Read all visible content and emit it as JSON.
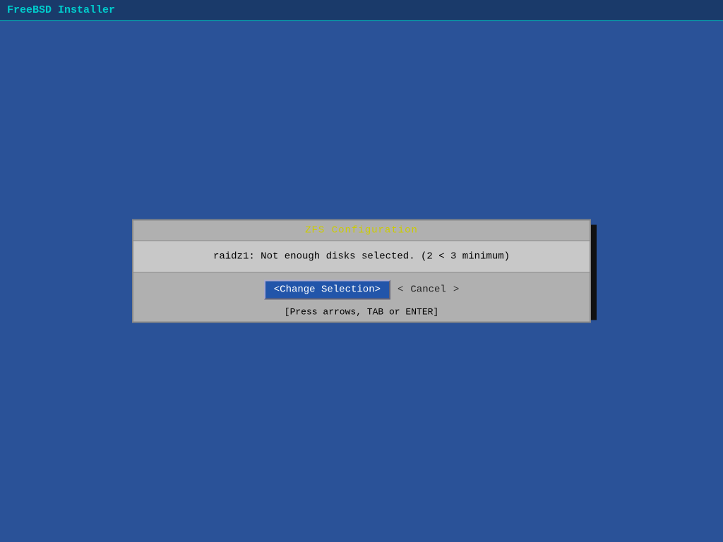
{
  "title_bar": {
    "label": "FreeBSD Installer"
  },
  "dialog": {
    "title": "ZFS Configuration",
    "message": "raidz1: Not enough disks selected. (2 < 3 minimum)",
    "buttons": {
      "change_selection": "<Change Selection>",
      "arrow_left": "<",
      "cancel": "Cancel",
      "arrow_right": ">"
    },
    "hint": "[Press arrows, TAB or ENTER]"
  }
}
